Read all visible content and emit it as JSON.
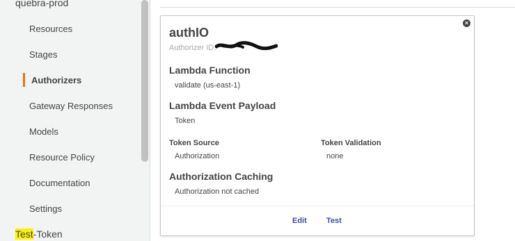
{
  "sidebar": {
    "api_name": "quebra-prod",
    "items": [
      {
        "label": "Resources"
      },
      {
        "label": "Stages"
      },
      {
        "label": "Authorizers",
        "active": true
      },
      {
        "label": "Gateway Responses"
      },
      {
        "label": "Models"
      },
      {
        "label": "Resource Policy"
      },
      {
        "label": "Documentation"
      },
      {
        "label": "Settings"
      }
    ],
    "authorizer_highlight": "Test",
    "authorizer_rest": "-Token"
  },
  "card": {
    "title": "authIO",
    "id_label": "Authorizer ID:",
    "close_icon": "close-icon",
    "lambda_function_heading": "Lambda Function",
    "lambda_function_value": "validate (us-east-1)",
    "event_payload_heading": "Lambda Event Payload",
    "event_payload_value": "Token",
    "token_source_heading": "Token Source",
    "token_source_value": "Authorization",
    "token_validation_heading": "Token Validation",
    "token_validation_value": "none",
    "caching_heading": "Authorization Caching",
    "caching_value": "Authorization not cached",
    "edit_label": "Edit",
    "test_label": "Test"
  },
  "colors": {
    "accent": "#ec7211",
    "link": "#3b4ba6",
    "highlight": "#fff200",
    "sidebar_bg": "#f2f3f3"
  }
}
